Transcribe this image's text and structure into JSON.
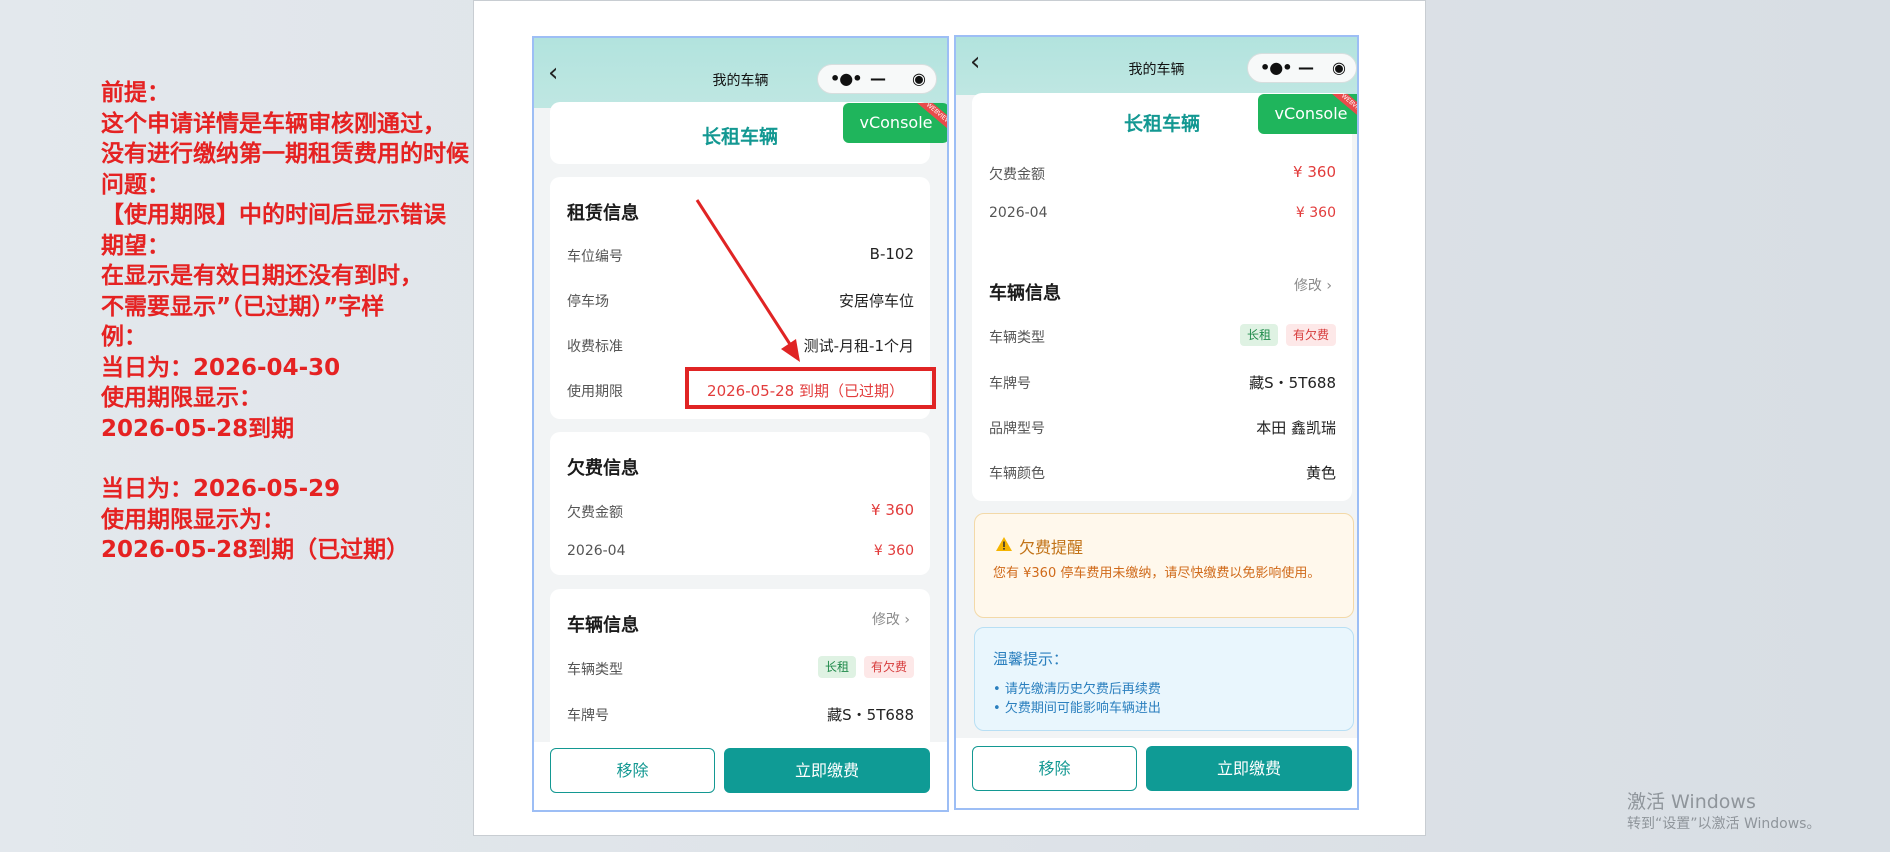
{
  "notes": [
    "前提：",
    "这个申请详情是车辆审核刚通过，",
    "没有进行缴纳第一期租赁费用的时候",
    "问题：",
    "【使用期限】中的时间后显示错误",
    "期望：",
    "在显示是有效日期还没有到时，",
    "不需要显示”（已过期）”字样",
    "例：",
    "当日为：2026-04-30",
    "使用期限显示：",
    "2026-05-28到期",
    "",
    "当日为：2026-05-29",
    "使用期限显示为：",
    "2026-05-28到期（已过期）"
  ],
  "app": {
    "nav_title": "我的车辆",
    "vconsole_label": "vConsole",
    "vconsole_ribbon": "WEBVIEW",
    "page_title": "长租车辆"
  },
  "rental": {
    "title": "租赁信息",
    "rows": [
      {
        "label": "车位编号",
        "value": "B-102"
      },
      {
        "label": "停车场",
        "value": "安居停车位"
      },
      {
        "label": "收费标准",
        "value": "测试-月租-1个月"
      },
      {
        "label": "使用期限",
        "value": "2026-05-28 到期（已过期）"
      }
    ]
  },
  "arrears": {
    "title": "欠费信息",
    "amount_label": "欠费金额",
    "amount_value": "¥ 360",
    "month_label": "2026-04",
    "month_value": "¥ 360"
  },
  "vehicle": {
    "title": "车辆信息",
    "edit_label": "修改",
    "type_label": "车辆类型",
    "tags": [
      "长租",
      "有欠费"
    ],
    "plate_label": "车牌号",
    "plate_value": "藏S・5T688",
    "model_label": "品牌型号",
    "model_value": "本田 鑫凯瑞",
    "color_label": "车辆颜色",
    "color_value": "黄色"
  },
  "warning": {
    "title": "欠费提醒",
    "text": "您有 ¥360 停车费用未缴纳，请尽快缴费以免影响使用。"
  },
  "tips": {
    "title": "温馨提示：",
    "items": [
      "请先缴清历史欠费后再续费",
      "欠费期间可能影响车辆进出"
    ]
  },
  "buttons": {
    "remove": "移除",
    "pay": "立即缴费"
  },
  "watermark": {
    "line1": "激活 Windows",
    "line2": "转到“设置”以激活 Windows。"
  },
  "colors": {
    "accent": "#0f9b95",
    "annotation": "#e52222",
    "warning": "#c27318"
  }
}
